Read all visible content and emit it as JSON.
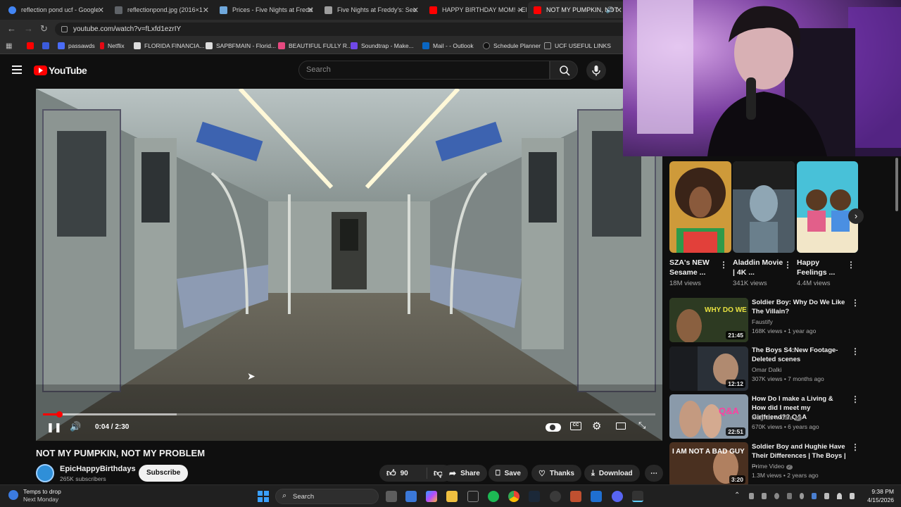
{
  "browser": {
    "tabs": [
      {
        "label": "reflection pond ucf - Google",
        "color": "#4285f4"
      },
      {
        "label": "reflectionpond.jpg (2016×1",
        "color": "#5f6368"
      },
      {
        "label": "Prices - Five Nights at Fredd",
        "color": "#6fa8dc"
      },
      {
        "label": "Five Nights at Freddy's: Sec",
        "color": "#9e9e9e"
      },
      {
        "label": "HAPPY BIRTHDAY MOM! - El",
        "color": "#ff0000"
      },
      {
        "label": "NOT MY PUMPKIN, NOT",
        "color": "#ff0000"
      }
    ],
    "url": "youtube.com/watch?v=fLxfd1ezrIY",
    "bookmarks": [
      {
        "label": "",
        "color": "#ff0000"
      },
      {
        "label": "",
        "color": "#3b5bdb"
      },
      {
        "label": "passawds",
        "color": "#4a6cf7"
      },
      {
        "label": "Netflix",
        "color": "#e50914"
      },
      {
        "label": "FLORIDA FINANCIA...",
        "color": "#dddddd"
      },
      {
        "label": "SAPBFMAIN - Florid...",
        "color": "#dddddd"
      },
      {
        "label": "BEAUTIFUL FULLY R...",
        "color": "#e64980"
      },
      {
        "label": "Soundtrap - Make...",
        "color": "#7048e8"
      },
      {
        "label": "Mail - - Outlook",
        "color": "#0a66c2"
      },
      {
        "label": "Schedule Planner",
        "color": "#222222"
      },
      {
        "label": "UCF USEFUL LINKS",
        "color": "#999999"
      }
    ]
  },
  "youtube": {
    "logo": "YouTube",
    "search_placeholder": "Search"
  },
  "player": {
    "time": "0:04 / 2:30",
    "progress": 0.027
  },
  "video": {
    "title": "NOT MY PUMPKIN, NOT MY PROBLEM",
    "channel": "EpicHappyBirthdays",
    "subscribers": "265K subscribers",
    "subscribe_label": "Subscribe",
    "likes": "90",
    "share_label": "Share",
    "save_label": "Save",
    "thanks_label": "Thanks",
    "download_label": "Download"
  },
  "shorts": [
    {
      "title": "SZA's NEW Sesame ...",
      "views": "18M views",
      "color": "#b5651d"
    },
    {
      "title": "Aladdin Movie | 4K ...",
      "views": "341K views",
      "color": "#5c6f7c"
    },
    {
      "title": "Happy Feelings ...",
      "views": "4.4M views",
      "color": "#48c1d8"
    }
  ],
  "recommendations": [
    {
      "title": "Soldier Boy: Why Do We Like The Villain?",
      "channel": "Faustify",
      "meta": "168K views • 1 year ago",
      "duration": "21:45",
      "verified": false,
      "thumb_text": "WHY DO WE LIKE",
      "color": "#3a4a2a"
    },
    {
      "title": "The Boys S4:New Footage-Deleted scenes",
      "channel": "Omar Dalki",
      "meta": "307K views • 7 months ago",
      "duration": "12:12",
      "verified": false,
      "thumb_text": "",
      "color": "#2a3038"
    },
    {
      "title": "How Do I make a Living & How did I meet my Girlfriend?? Q&A",
      "channel": "Magnus Midtbø",
      "meta": "670K views • 6 years ago",
      "duration": "22:51",
      "verified": true,
      "thumb_text": "Q&A",
      "color": "#6a7a8a"
    },
    {
      "title": "Soldier Boy and Hughie Have Their Differences | The Boys | ...",
      "channel": "Prime Video",
      "meta": "1.3M views • 2 years ago",
      "duration": "3:20",
      "verified": true,
      "thumb_text": "I AM NOT A BAD GUY",
      "color": "#4a3020"
    }
  ],
  "taskbar": {
    "weather_title": "Temps to drop",
    "weather_sub": "Next Monday",
    "search_label": "Search",
    "time": "9:38 PM",
    "date": "4/15/2026"
  }
}
